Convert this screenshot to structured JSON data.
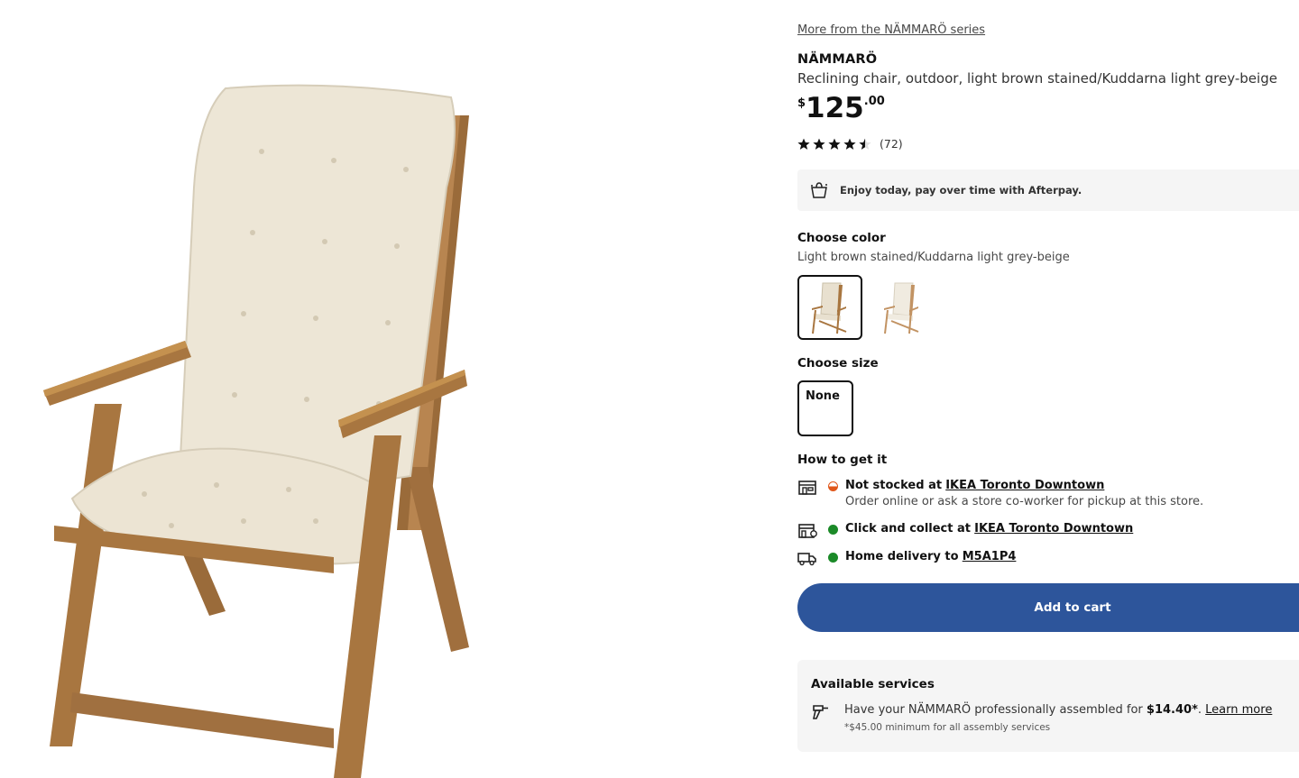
{
  "product": {
    "series_link": "More from the NÄMMARÖ series",
    "name": "NÄMMARÖ",
    "description": "Reclining chair, outdoor, light brown stained/Kuddarna light grey-beige",
    "price": {
      "currency": "$",
      "whole": "125",
      "decimal": ".00"
    },
    "rating": {
      "stars": 4.5,
      "out_of": 5,
      "count_label": "(72)"
    }
  },
  "afterpay": {
    "text": "Enjoy today, pay over time with Afterpay."
  },
  "color": {
    "label": "Choose color",
    "selected_value": "Light brown stained/Kuddarna light grey-beige"
  },
  "size": {
    "label": "Choose size",
    "option": "None"
  },
  "availability": {
    "label": "How to get it",
    "store_stock": {
      "prefix": "Not stocked at",
      "store": "IKEA Toronto Downtown",
      "note": "Order online or ask a store co-worker for pickup at this store."
    },
    "click_collect": {
      "prefix": "Click and collect at",
      "store": "IKEA Toronto Downtown"
    },
    "delivery": {
      "prefix": "Home delivery to",
      "postal": "M5A1P4"
    }
  },
  "cart": {
    "button_label": "Add to cart"
  },
  "services": {
    "title": "Available services",
    "text_before": "Have your NÄMMARÖ professionally assembled for",
    "price": "$14.40*",
    "text_after": ".",
    "learn_more": "Learn more",
    "note": "*$45.00 minimum for all assembly services"
  },
  "colors": {
    "accent": "#2d559b",
    "in_stock": "#1b8a28",
    "not_stocked": "#e0571a",
    "panel_bg": "#f5f5f5"
  },
  "icons": {
    "afterpay": "shopping-bag-icon",
    "store": "store-icon",
    "click_collect": "store-pickup-icon",
    "delivery": "truck-icon",
    "assembly": "drill-icon"
  }
}
